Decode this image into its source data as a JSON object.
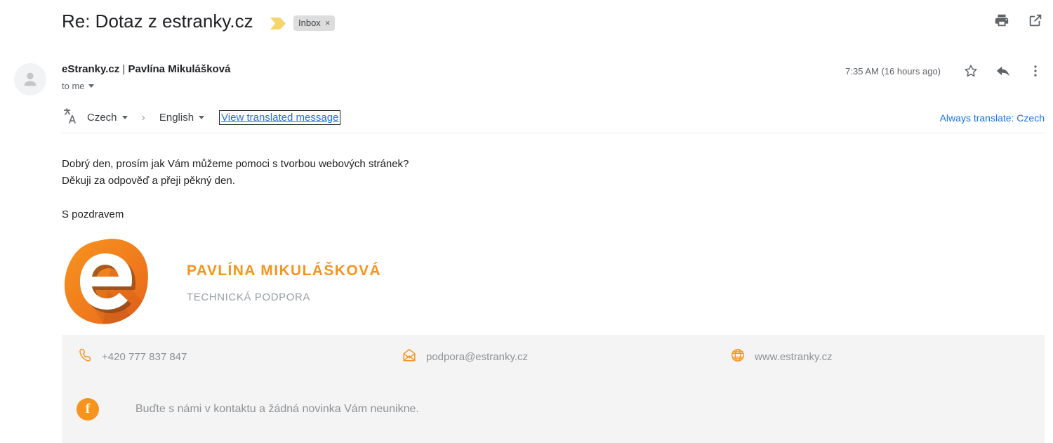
{
  "subject": {
    "title": "Re: Dotaz z estranky.cz",
    "important_marker_icon": "important-marker-icon",
    "label": "Inbox",
    "label_close": "×"
  },
  "toolbar": {
    "print_icon": "print-icon",
    "open_in_new_icon": "open-in-new-window-icon"
  },
  "sender": {
    "org": "eStranky.cz",
    "separator": " | ",
    "person": "Pavlína Mikulášková",
    "recipients": "to me",
    "timestamp": "7:35 AM (16 hours ago)",
    "star_icon": "star-icon",
    "reply_icon": "reply-icon",
    "more_icon": "more-options-icon",
    "avatar_icon": "default-avatar-icon"
  },
  "translate": {
    "icon": "translate-icon",
    "source_lang": "Czech",
    "arrow": "›",
    "target_lang": "English",
    "view_link": "View translated message",
    "always_link": "Always translate: Czech"
  },
  "message": {
    "line1": "Dobrý den, prosím jak Vám můžeme pomoci s tvorbou webových stránek?",
    "line2": "Děkuji za odpověď a přeji pěkný den.",
    "line3": "S pozdravem"
  },
  "signature": {
    "logo_icon": "estranky-logo-icon",
    "name": "PAVLÍNA MIKULÁŠKOVÁ",
    "role": "TECHNICKÁ PODPORA",
    "name_color": "#f7941e"
  },
  "footer": {
    "phone_icon": "phone-icon",
    "phone": "+420 777 837 847",
    "email_icon": "envelope-icon",
    "email": "podpora@estranky.cz",
    "web_icon": "globe-icon",
    "web": "www.estranky.cz",
    "facebook_icon": "facebook-icon",
    "facebook_glyph": "f",
    "social_text": "Buďte s námi v kontaktu a žádná novinka Vám neunikne.",
    "accent_color": "#f7941e",
    "panel_color": "#f4f4f4"
  }
}
